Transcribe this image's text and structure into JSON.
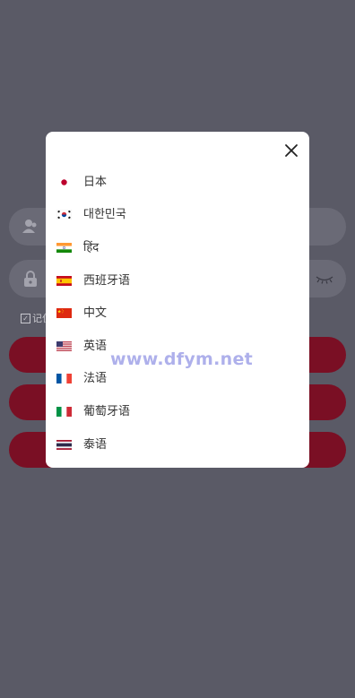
{
  "background": {
    "overlay_color": "#5a5a66",
    "button_color": "#7a0f24",
    "remember_label": "记住"
  },
  "modal": {
    "close_icon": "close-icon",
    "languages": [
      {
        "label": "日本",
        "flag": "japan-flag-icon"
      },
      {
        "label": "대한민국",
        "flag": "south-korea-flag-icon"
      },
      {
        "label": "हिंद",
        "flag": "india-flag-icon"
      },
      {
        "label": "西班牙语",
        "flag": "spain-flag-icon"
      },
      {
        "label": "中文",
        "flag": "china-flag-icon"
      },
      {
        "label": "英语",
        "flag": "usa-flag-icon"
      },
      {
        "label": "法语",
        "flag": "france-flag-icon"
      },
      {
        "label": "葡萄牙语",
        "flag": "italy-flag-icon"
      },
      {
        "label": "泰语",
        "flag": "thailand-flag-icon"
      }
    ]
  },
  "watermark": "www.dfym.net"
}
